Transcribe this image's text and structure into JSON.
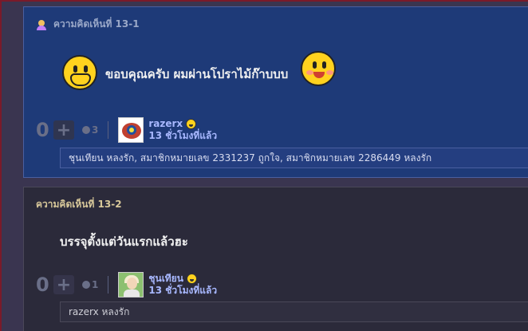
{
  "comments": [
    {
      "header": "ความคิดเห็นที่ 13-1",
      "text": "ขอบคุณครับ ผมผ่านโปราไม้ก๊าบบบ",
      "score": "0",
      "reactions": "3",
      "author": "razerx",
      "time": "13 ชั่วโมงที่แล้ว",
      "likes": "ชุนเทียน หลงรัก, สมาชิกหมายเลข 2331237 ถูกใจ, สมาชิกหมายเลข 2286449 หลงรัก"
    },
    {
      "header": "ความคิดเห็นที่ 13-2",
      "text": "บรรจุตั้งแต่วันแรกแล้วฮะ",
      "score": "0",
      "reactions": "1",
      "author": "ชุนเทียน",
      "time": "13 ชั่วโมงที่แล้ว",
      "likes": "razerx หลงรัก"
    }
  ],
  "icons": {
    "plus": "+",
    "header_icon": "user-icon",
    "reaction_icon": "emotion-icon"
  },
  "colors": {
    "comment1_bg": "#1e3a78",
    "comment2_bg": "#2b2a3a",
    "link": "#a8b8ff",
    "header_gold": "#d8c89a"
  }
}
